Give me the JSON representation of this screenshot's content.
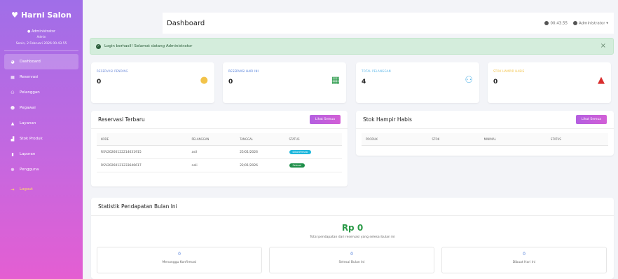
{
  "sidebar": {
    "brand": "Harni Salon",
    "user_name": "Administrator",
    "user_role": "Admin",
    "date": "Senin, 2 Februari 2026 00.43.55",
    "items": [
      {
        "label": "Dashboard",
        "icon": "dashboard-icon"
      },
      {
        "label": "Reservasi",
        "icon": "calendar-icon"
      },
      {
        "label": "Pelanggan",
        "icon": "users-icon"
      },
      {
        "label": "Pegawai",
        "icon": "user-icon"
      },
      {
        "label": "Layanan",
        "icon": "scissors-icon"
      },
      {
        "label": "Stok Produk",
        "icon": "boxes-icon"
      },
      {
        "label": "Laporan",
        "icon": "chart-icon"
      },
      {
        "label": "Pengguna",
        "icon": "user-cog-icon"
      },
      {
        "label": "Logout",
        "icon": "logout-icon"
      }
    ]
  },
  "topbar": {
    "title": "Dashboard",
    "time": "00.43.55",
    "account": "Administrator"
  },
  "alert": {
    "message": "Login berhasil! Selamat datang Administrator"
  },
  "stats": [
    {
      "label": "RESERVASI PENDING",
      "value": "0",
      "icon": "clock-icon"
    },
    {
      "label": "RESERVASI HARI INI",
      "value": "0",
      "icon": "calendar-day-icon"
    },
    {
      "label": "TOTAL PELANGGAN",
      "value": "4",
      "icon": "users-icon"
    },
    {
      "label": "STOK HAMPIR HABIS",
      "value": "0",
      "icon": "warning-icon"
    }
  ],
  "reservasi": {
    "title": "Reservasi Terbaru",
    "button": "Lihat Semua",
    "columns": [
      "KODE",
      "PELANGGAN",
      "TANGGAL",
      "STATUS"
    ],
    "rows": [
      {
        "kode": "RSV20260122214631915",
        "pelanggan": "asil",
        "tanggal": "25/01/2026",
        "status": "Dikonfirmasi"
      },
      {
        "kode": "RSV20260121233646617",
        "pelanggan": "neli",
        "tanggal": "22/01/2026",
        "status": "Selesai"
      }
    ]
  },
  "stok": {
    "title": "Stok Hampir Habis",
    "button": "Lihat Semua",
    "columns": [
      "PRODUK",
      "STOK",
      "MINIMAL",
      "STATUS"
    ]
  },
  "pendapatan": {
    "title": "Statistik Pendapatan Bulan Ini",
    "amount": "Rp 0",
    "caption": "Total pendapatan dari reservasi yang selesai bulan ini",
    "cards": [
      {
        "value": "0",
        "label": "Menunggu Konfirmasi"
      },
      {
        "value": "0",
        "label": "Selesai Bulan Ini"
      },
      {
        "value": "0",
        "label": "Dibuat Hari Ini"
      }
    ]
  }
}
